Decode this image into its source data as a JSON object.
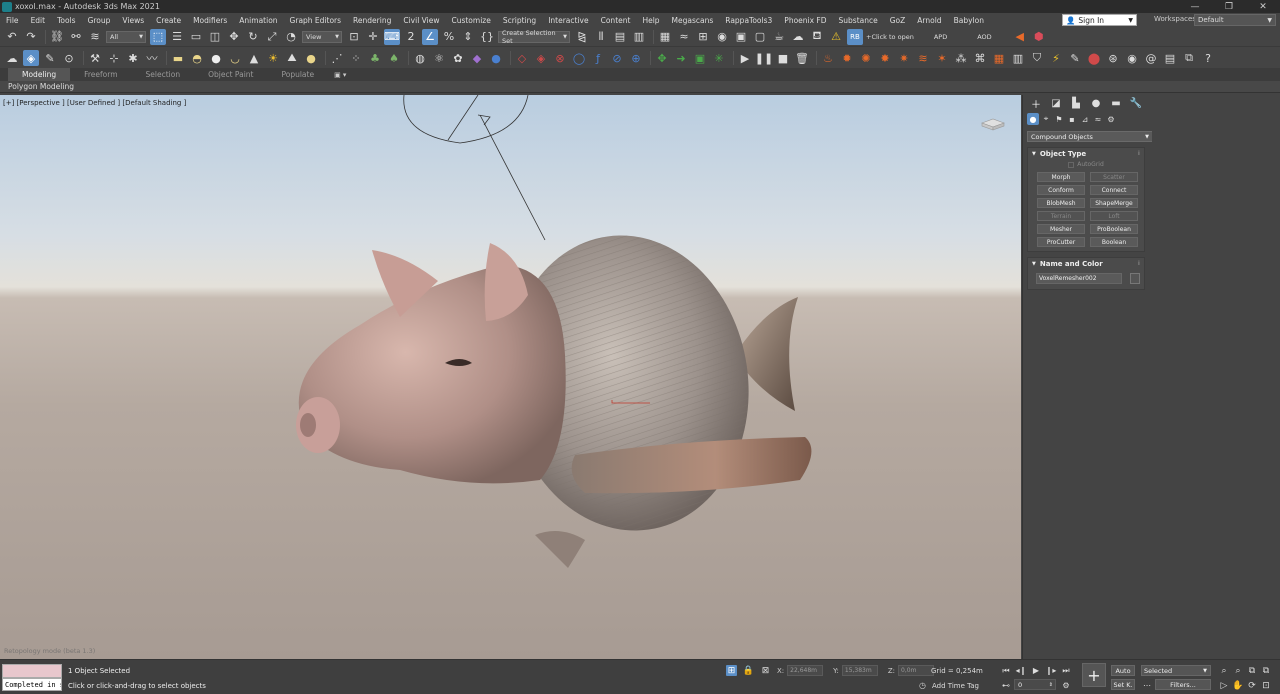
{
  "window": {
    "title": "xoxol.max - Autodesk 3ds Max 2021",
    "controls": [
      "—",
      "❐",
      "✕"
    ]
  },
  "menubar": {
    "items": [
      "File",
      "Edit",
      "Tools",
      "Group",
      "Views",
      "Create",
      "Modifiers",
      "Animation",
      "Graph Editors",
      "Rendering",
      "Civil View",
      "Customize",
      "Scripting",
      "Interactive",
      "Content",
      "Help",
      "Megascans",
      "RappaTools3",
      "Phoenix FD",
      "Substance",
      "GoZ",
      "Arnold",
      "Babylon"
    ],
    "signin": "Sign In",
    "workspace_label": "Workspaces:",
    "workspace_value": "Default"
  },
  "toolbar1": {
    "filter_select": "All",
    "view_select": "View",
    "selection_set": "Create Selection Set",
    "rb_label": "RB",
    "click_to_open": "+Click to open",
    "apd": "APD",
    "aod": "AOD"
  },
  "ribbon": {
    "tabs": [
      "Modeling",
      "Freeform",
      "Selection",
      "Object Paint",
      "Populate"
    ],
    "active_tab": "Modeling",
    "sub": "Polygon Modeling"
  },
  "viewport": {
    "label": "[+] [Perspective ] [User Defined ] [Default Shading ]",
    "footer": "Retopology mode (beta 1.3)"
  },
  "command_panel": {
    "category": "Compound Objects",
    "object_type_title": "Object Type",
    "autogrid": "AutoGrid",
    "buttons": [
      {
        "label": "Morph",
        "enabled": true
      },
      {
        "label": "Scatter",
        "enabled": false
      },
      {
        "label": "Conform",
        "enabled": true
      },
      {
        "label": "Connect",
        "enabled": true
      },
      {
        "label": "BlobMesh",
        "enabled": true
      },
      {
        "label": "ShapeMerge",
        "enabled": true
      },
      {
        "label": "Terrain",
        "enabled": false
      },
      {
        "label": "Loft",
        "enabled": false
      },
      {
        "label": "Mesher",
        "enabled": true
      },
      {
        "label": "ProBoolean",
        "enabled": true
      },
      {
        "label": "ProCutter",
        "enabled": true
      },
      {
        "label": "Boolean",
        "enabled": true
      }
    ],
    "name_color_title": "Name and Color",
    "object_name": "VoxelRemesher002"
  },
  "statusbar": {
    "maxscript_output": "Completed in s",
    "selection_status": "1 Object Selected",
    "prompt": "Click or click-and-drag to select objects",
    "x_label": "X:",
    "x_value": "22,648m",
    "y_label": "Y:",
    "y_value": "15,383m",
    "z_label": "Z:",
    "z_value": "0,0m",
    "grid": "Grid = 0,254m",
    "add_time_tag": "Add Time Tag",
    "frame": "0",
    "auto_key": "Auto",
    "set_key": "Set K.",
    "selection_filter": "Selected",
    "filters": "Filters..."
  },
  "colors": {
    "accent": "#5b8fc7",
    "ui_bg": "#444444",
    "maxscript_bg": "#e8c7cd"
  }
}
